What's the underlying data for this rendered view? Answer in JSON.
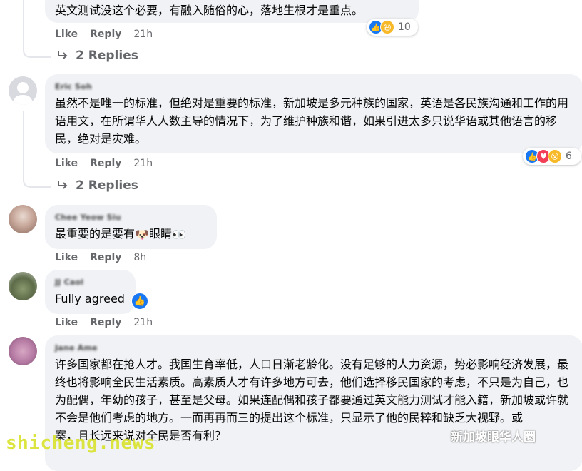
{
  "comments": [
    {
      "text": "英文测试没这个必要，有融入随俗的心，落地生根才是重点。",
      "like": "Like",
      "reply": "Reply",
      "time": "21h",
      "reaction_count": "10",
      "replies_label": "2 Replies"
    },
    {
      "author": "Eric Soh",
      "text": "虽然不是唯一的标准，但绝对是重要的标准，新加坡是多元种族的国家，英语是各民族沟通和工作的用语用文，在所谓华人人数主导的情况下，为了维护种族和谐，如果引进太多只说华语或其他语言的移民，绝对是灾难。",
      "like": "Like",
      "reply": "Reply",
      "time": "21h",
      "reaction_count": "6",
      "replies_label": "2 Replies"
    },
    {
      "author": "Chee Yeow Siu",
      "text_a": "最重要的是要有",
      "text_b": "眼睛",
      "like": "Like",
      "reply": "Reply",
      "time": "8h"
    },
    {
      "author": "JJ Caol",
      "text": "Fully agreed",
      "like": "Like",
      "reply": "Reply",
      "time": "21h"
    },
    {
      "author": "Jane Ame",
      "text": "许多国家都在抢人才。我国生育率低，人口日渐老龄化。没有足够的人力资源，势必影响经济发展，最终也将影响全民生活素质。高素质人才有许多地方可去，他们选择移民国家的考虑，不只是为自己，也为配偶，年幼的孩子，甚至是父母。如果连配偶和孩子都要通过英文能力测试才能入籍，新加坡或许就不会是他们考虑的地方。一而再再而三的提出这个标准，只显示了他的民粹和缺乏大视野。或",
      "text_tail": "案，且长远来说对全民是否有利？"
    }
  ],
  "watermark": "shicheng.news",
  "watermark_right": "新加坡眼华人圈",
  "colors": {
    "like_blue": "#1877f2",
    "love_red": "#f33e58",
    "haha_yellow": "#f7b928",
    "bubble": "#f0f2f5",
    "meta_gray": "#65676b"
  }
}
